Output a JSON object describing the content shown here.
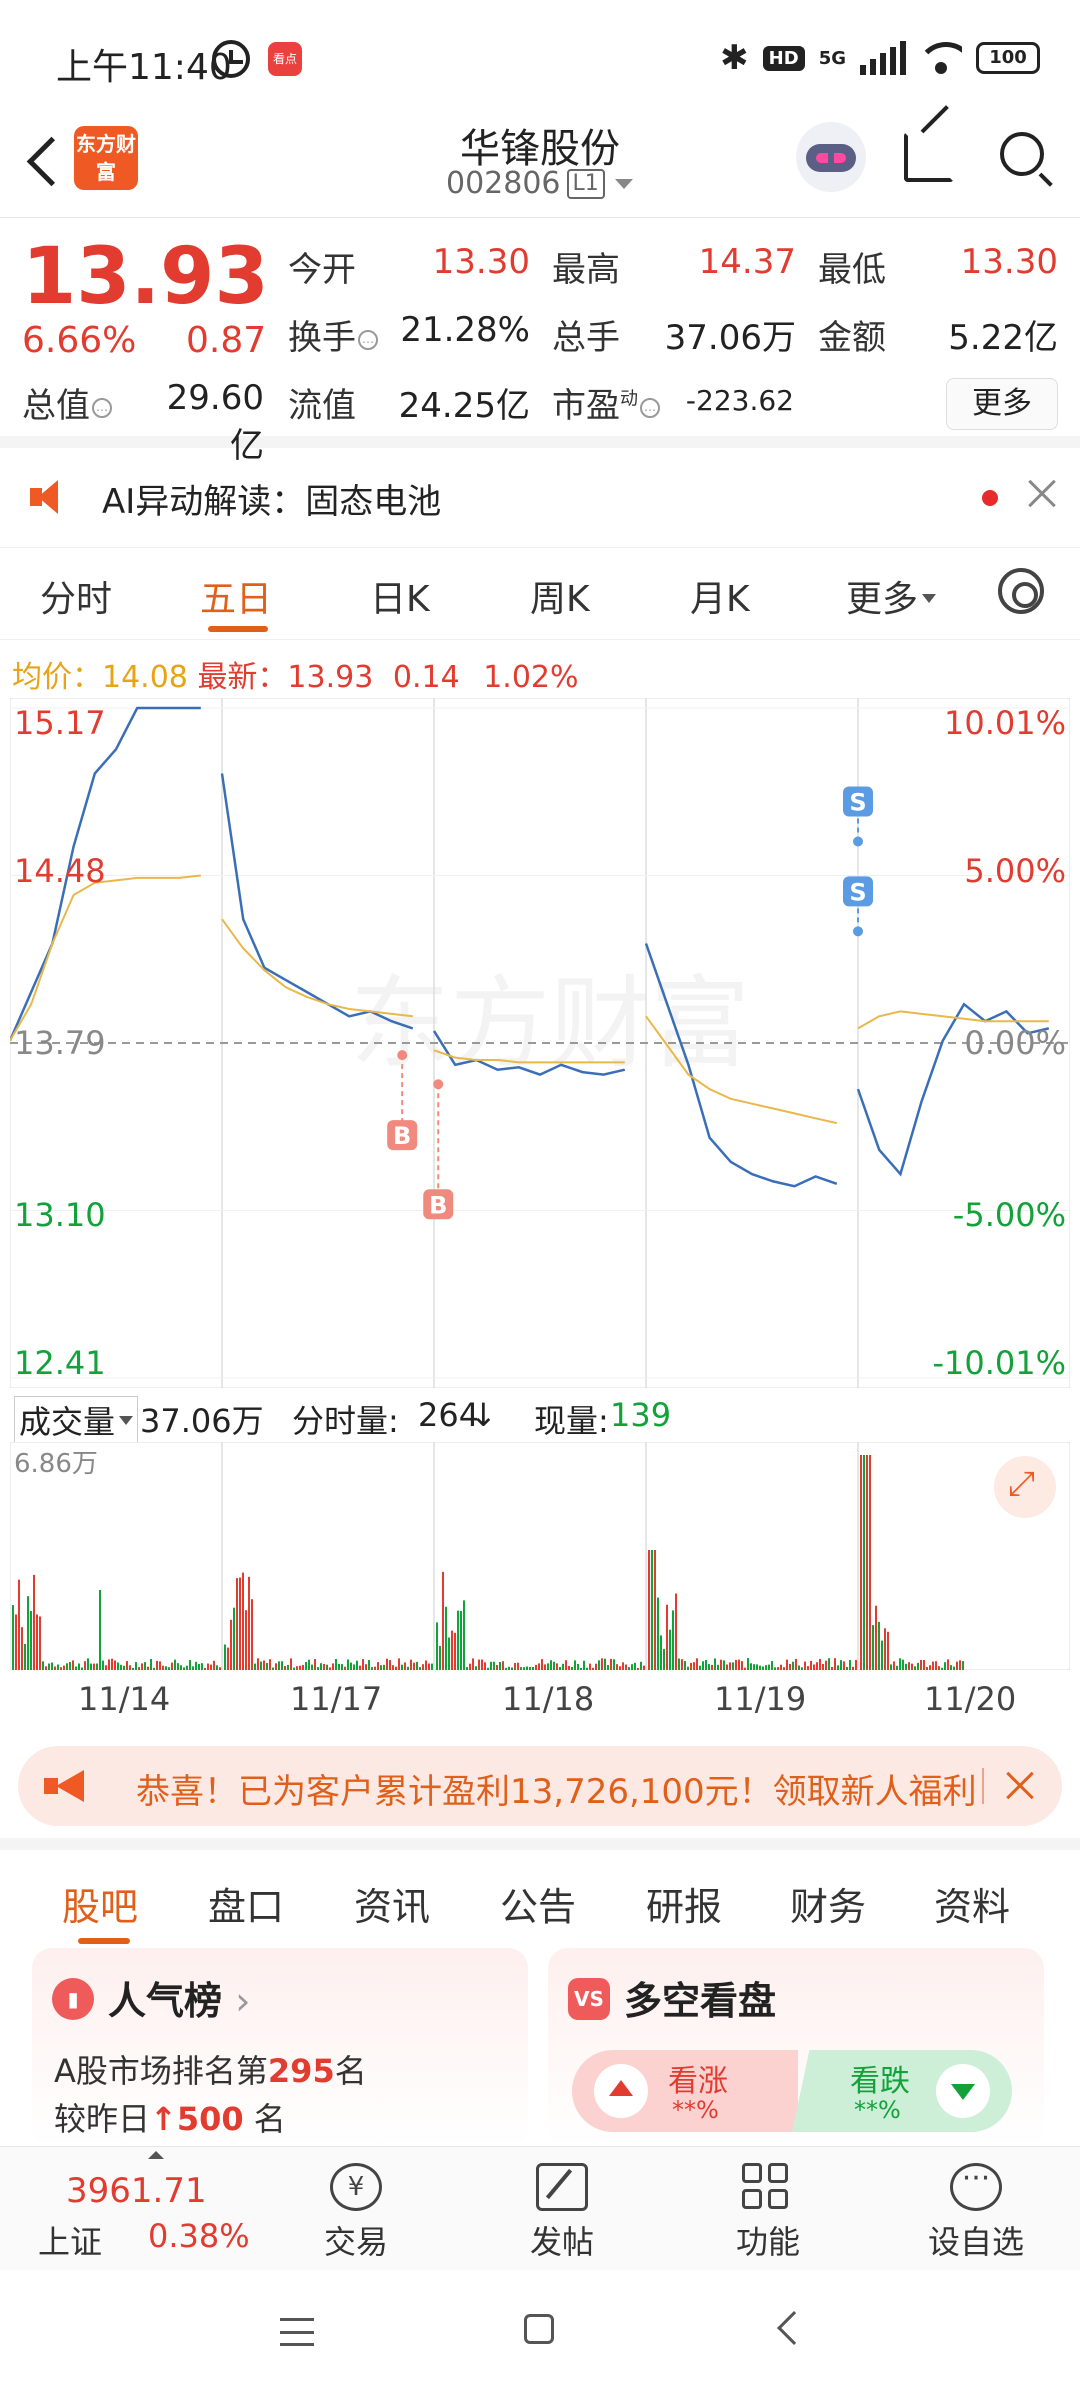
{
  "status_bar": {
    "time": "上午11:40",
    "kanzhe_icon": "看点",
    "hd_badge": "HD",
    "network": "5G",
    "battery": "100"
  },
  "header": {
    "logo_text": "东方财富",
    "stock_name": "华锋股份",
    "stock_code": "002806",
    "level_badge": "L1"
  },
  "quote": {
    "price": "13.93",
    "change_pct": "6.66%",
    "change_amt": "0.87",
    "fields": {
      "open_label": "今开",
      "open": "13.30",
      "high_label": "最高",
      "high": "14.37",
      "low_label": "最低",
      "low": "13.30",
      "turnover_label": "换手",
      "turnover": "21.28%",
      "volume_label": "总手",
      "volume": "37.06万",
      "amount_label": "金额",
      "amount": "5.22亿",
      "mktcap_label": "总值",
      "mktcap": "29.60亿",
      "float_label": "流值",
      "float": "24.25亿",
      "pe_label": "市盈",
      "pe_sup": "动",
      "pe": "-223.62"
    },
    "more_button": "更多"
  },
  "ai_bar": {
    "text": "AI异动解读：固态电池"
  },
  "chart_tabs": {
    "items": [
      "分时",
      "五日",
      "日K",
      "周K",
      "月K",
      "更多"
    ],
    "active": "五日"
  },
  "avg_row": {
    "avg_label": "均价：14.08",
    "latest_label": "最新：13.93",
    "chg": "0.14",
    "pct": "1.02%"
  },
  "chart_data": {
    "type": "line",
    "watermark": "东方财富",
    "y_left_ticks": [
      "15.17",
      "14.48",
      "13.79",
      "13.10",
      "12.41"
    ],
    "y_right_ticks": [
      "10.01%",
      "5.00%",
      "0.00%",
      "-5.00%",
      "-10.01%"
    ],
    "ylim": [
      12.41,
      15.17
    ],
    "prev_close": 13.79,
    "x_days": [
      "11/14",
      "11/17",
      "11/18",
      "11/19",
      "11/20"
    ],
    "series": [
      {
        "values": [
          13.8,
          14.0,
          14.2,
          14.6,
          14.9,
          15.0,
          15.17,
          15.17,
          15.17,
          15.17,
          14.9,
          14.3,
          14.1,
          14.05,
          14.0,
          13.95,
          13.9,
          13.92,
          13.88,
          13.85,
          13.84,
          13.7,
          13.72,
          13.68,
          13.69,
          13.66,
          13.7,
          13.67,
          13.66,
          13.68,
          14.2,
          13.95,
          13.7,
          13.4,
          13.3,
          13.25,
          13.22,
          13.2,
          13.24,
          13.21,
          13.6,
          13.35,
          13.25,
          13.55,
          13.8,
          13.95,
          13.88,
          13.92,
          13.83,
          13.85
        ]
      },
      {
        "values": [
          13.8,
          13.95,
          14.2,
          14.4,
          14.45,
          14.46,
          14.47,
          14.47,
          14.47,
          14.48,
          14.3,
          14.18,
          14.09,
          14.02,
          13.98,
          13.95,
          13.93,
          13.92,
          13.91,
          13.9,
          13.76,
          13.73,
          13.72,
          13.72,
          13.71,
          13.71,
          13.71,
          13.71,
          13.71,
          13.71,
          13.9,
          13.78,
          13.66,
          13.6,
          13.56,
          13.54,
          13.52,
          13.5,
          13.48,
          13.46,
          13.85,
          13.9,
          13.92,
          13.91,
          13.9,
          13.89,
          13.88,
          13.88,
          13.88,
          13.88
        ]
      }
    ],
    "markers": [
      {
        "label": "B",
        "day": 1,
        "value": 13.74
      },
      {
        "label": "B",
        "day": 2,
        "value": 13.62
      },
      {
        "label": "S",
        "day": 4,
        "value": 14.25
      },
      {
        "label": "S",
        "day": 4,
        "value": 14.62
      }
    ],
    "volume_max_label": "6.86万"
  },
  "vol_row": {
    "selector": "成交量",
    "volume": "37.06万",
    "tick_label": "分时量:",
    "tick_value": "264",
    "now_label": "现量:",
    "now_value": "139"
  },
  "promo": {
    "text": "恭喜！已为客户累计盈利13,726,100元！领取新人福利"
  },
  "sub_tabs": {
    "items": [
      "股吧",
      "盘口",
      "资讯",
      "公告",
      "研报",
      "财务",
      "资料"
    ],
    "active": "股吧"
  },
  "popularity_card": {
    "title": "人气榜",
    "rank_prefix": "A股市场排名第",
    "rank": "295",
    "rank_suffix": "名",
    "change_prefix": "较昨日",
    "change": "500",
    "change_suffix": "名"
  },
  "bull_bear_card": {
    "title": "多空看盘",
    "bull_label": "看涨",
    "bull_value": "**%",
    "bear_label": "看跌",
    "bear_value": "**%"
  },
  "bottom_nav": {
    "index_value": "3961.71",
    "index_name": "上证",
    "index_pct": "0.38%",
    "items": [
      "交易",
      "发帖",
      "功能",
      "设自选"
    ]
  }
}
